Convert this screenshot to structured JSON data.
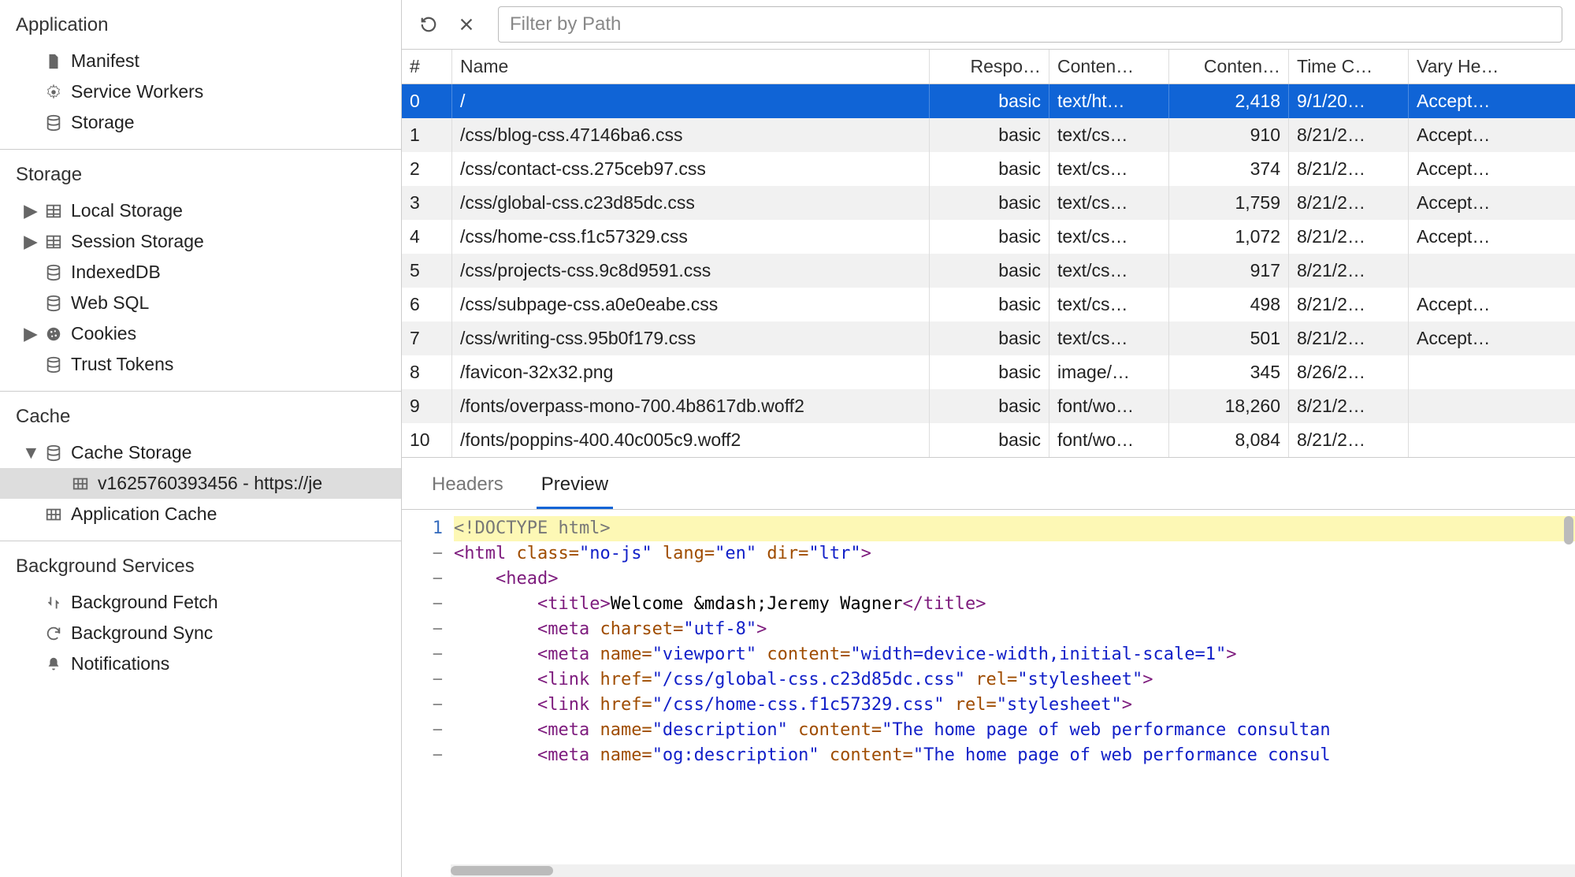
{
  "sidebar": {
    "groups": [
      {
        "title": "Application",
        "items": [
          {
            "icon": "file-icon",
            "label": "Manifest",
            "expandable": false
          },
          {
            "icon": "gear-icon",
            "label": "Service Workers",
            "expandable": false
          },
          {
            "icon": "storage-icon",
            "label": "Storage",
            "expandable": false
          }
        ]
      },
      {
        "title": "Storage",
        "items": [
          {
            "icon": "table-icon",
            "label": "Local Storage",
            "expandable": true
          },
          {
            "icon": "table-icon",
            "label": "Session Storage",
            "expandable": true
          },
          {
            "icon": "storage-icon",
            "label": "IndexedDB",
            "expandable": false
          },
          {
            "icon": "storage-icon",
            "label": "Web SQL",
            "expandable": false
          },
          {
            "icon": "cookie-icon",
            "label": "Cookies",
            "expandable": true
          },
          {
            "icon": "storage-icon",
            "label": "Trust Tokens",
            "expandable": false
          }
        ]
      },
      {
        "title": "Cache",
        "items": [
          {
            "icon": "storage-icon",
            "label": "Cache Storage",
            "expandable": true,
            "expanded": true,
            "children": [
              {
                "icon": "cells-icon",
                "label": "v1625760393456 - https://je",
                "selected": true
              }
            ]
          },
          {
            "icon": "cells-icon",
            "label": "Application Cache",
            "expandable": false
          }
        ]
      },
      {
        "title": "Background Services",
        "items": [
          {
            "icon": "fetch-icon",
            "label": "Background Fetch",
            "expandable": false
          },
          {
            "icon": "sync-icon",
            "label": "Background Sync",
            "expandable": false
          },
          {
            "icon": "bell-icon",
            "label": "Notifications",
            "expandable": false
          }
        ]
      }
    ]
  },
  "toolbar": {
    "filter_placeholder": "Filter by Path"
  },
  "table": {
    "columns": [
      {
        "key": "index",
        "label": "#"
      },
      {
        "key": "name",
        "label": "Name"
      },
      {
        "key": "resp",
        "label": "Respo…"
      },
      {
        "key": "ctype",
        "label": "Conten…"
      },
      {
        "key": "clen",
        "label": "Conten…"
      },
      {
        "key": "time",
        "label": "Time C…"
      },
      {
        "key": "vary",
        "label": "Vary He…"
      }
    ],
    "rows": [
      {
        "index": "0",
        "name": "/",
        "resp": "basic",
        "ctype": "text/ht…",
        "clen": "2,418",
        "time": "9/1/20…",
        "vary": "Accept…",
        "selected": true
      },
      {
        "index": "1",
        "name": "/css/blog-css.47146ba6.css",
        "resp": "basic",
        "ctype": "text/cs…",
        "clen": "910",
        "time": "8/21/2…",
        "vary": "Accept…"
      },
      {
        "index": "2",
        "name": "/css/contact-css.275ceb97.css",
        "resp": "basic",
        "ctype": "text/cs…",
        "clen": "374",
        "time": "8/21/2…",
        "vary": "Accept…"
      },
      {
        "index": "3",
        "name": "/css/global-css.c23d85dc.css",
        "resp": "basic",
        "ctype": "text/cs…",
        "clen": "1,759",
        "time": "8/21/2…",
        "vary": "Accept…"
      },
      {
        "index": "4",
        "name": "/css/home-css.f1c57329.css",
        "resp": "basic",
        "ctype": "text/cs…",
        "clen": "1,072",
        "time": "8/21/2…",
        "vary": "Accept…"
      },
      {
        "index": "5",
        "name": "/css/projects-css.9c8d9591.css",
        "resp": "basic",
        "ctype": "text/cs…",
        "clen": "917",
        "time": "8/21/2…",
        "vary": ""
      },
      {
        "index": "6",
        "name": "/css/subpage-css.a0e0eabe.css",
        "resp": "basic",
        "ctype": "text/cs…",
        "clen": "498",
        "time": "8/21/2…",
        "vary": "Accept…"
      },
      {
        "index": "7",
        "name": "/css/writing-css.95b0f179.css",
        "resp": "basic",
        "ctype": "text/cs…",
        "clen": "501",
        "time": "8/21/2…",
        "vary": "Accept…"
      },
      {
        "index": "8",
        "name": "/favicon-32x32.png",
        "resp": "basic",
        "ctype": "image/…",
        "clen": "345",
        "time": "8/26/2…",
        "vary": ""
      },
      {
        "index": "9",
        "name": "/fonts/overpass-mono-700.4b8617db.woff2",
        "resp": "basic",
        "ctype": "font/wo…",
        "clen": "18,260",
        "time": "8/21/2…",
        "vary": ""
      },
      {
        "index": "10",
        "name": "/fonts/poppins-400.40c005c9.woff2",
        "resp": "basic",
        "ctype": "font/wo…",
        "clen": "8,084",
        "time": "8/21/2…",
        "vary": ""
      }
    ]
  },
  "subtabs": {
    "headers": "Headers",
    "preview": "Preview",
    "active": "preview"
  },
  "code": {
    "first_line_number": "1",
    "lines": [
      {
        "gutter": "1",
        "hl": true,
        "tokens": [
          {
            "c": "tok-doct",
            "t": "<!DOCTYPE html>"
          }
        ]
      },
      {
        "gutter": "−",
        "tokens": [
          {
            "c": "tok-tag",
            "t": "<html "
          },
          {
            "c": "tok-attr",
            "t": "class="
          },
          {
            "c": "tok-str",
            "t": "\"no-js\""
          },
          {
            "c": "tok-tag",
            "t": " "
          },
          {
            "c": "tok-attr",
            "t": "lang="
          },
          {
            "c": "tok-str",
            "t": "\"en\""
          },
          {
            "c": "tok-tag",
            "t": " "
          },
          {
            "c": "tok-attr",
            "t": "dir="
          },
          {
            "c": "tok-str",
            "t": "\"ltr\""
          },
          {
            "c": "tok-tag",
            "t": ">"
          }
        ]
      },
      {
        "gutter": "−",
        "indent": 1,
        "tokens": [
          {
            "c": "tok-tag",
            "t": "<head>"
          }
        ]
      },
      {
        "gutter": "−",
        "indent": 2,
        "tokens": [
          {
            "c": "tok-tag",
            "t": "<title>"
          },
          {
            "c": "tok-text",
            "t": "Welcome &mdash;Jeremy Wagner"
          },
          {
            "c": "tok-tag",
            "t": "</title>"
          }
        ]
      },
      {
        "gutter": "−",
        "indent": 2,
        "tokens": [
          {
            "c": "tok-tag",
            "t": "<meta "
          },
          {
            "c": "tok-attr",
            "t": "charset="
          },
          {
            "c": "tok-str",
            "t": "\"utf-8\""
          },
          {
            "c": "tok-tag",
            "t": ">"
          }
        ]
      },
      {
        "gutter": "−",
        "indent": 2,
        "tokens": [
          {
            "c": "tok-tag",
            "t": "<meta "
          },
          {
            "c": "tok-attr",
            "t": "name="
          },
          {
            "c": "tok-str",
            "t": "\"viewport\""
          },
          {
            "c": "tok-tag",
            "t": " "
          },
          {
            "c": "tok-attr",
            "t": "content="
          },
          {
            "c": "tok-str",
            "t": "\"width=device-width,initial-scale=1\""
          },
          {
            "c": "tok-tag",
            "t": ">"
          }
        ]
      },
      {
        "gutter": "−",
        "indent": 2,
        "tokens": [
          {
            "c": "tok-tag",
            "t": "<link "
          },
          {
            "c": "tok-attr",
            "t": "href="
          },
          {
            "c": "tok-str",
            "t": "\"/css/global-css.c23d85dc.css\""
          },
          {
            "c": "tok-tag",
            "t": " "
          },
          {
            "c": "tok-attr",
            "t": "rel="
          },
          {
            "c": "tok-str",
            "t": "\"stylesheet\""
          },
          {
            "c": "tok-tag",
            "t": ">"
          }
        ]
      },
      {
        "gutter": "−",
        "indent": 2,
        "tokens": [
          {
            "c": "tok-tag",
            "t": "<link "
          },
          {
            "c": "tok-attr",
            "t": "href="
          },
          {
            "c": "tok-str",
            "t": "\"/css/home-css.f1c57329.css\""
          },
          {
            "c": "tok-tag",
            "t": " "
          },
          {
            "c": "tok-attr",
            "t": "rel="
          },
          {
            "c": "tok-str",
            "t": "\"stylesheet\""
          },
          {
            "c": "tok-tag",
            "t": ">"
          }
        ]
      },
      {
        "gutter": "−",
        "indent": 2,
        "tokens": [
          {
            "c": "tok-tag",
            "t": "<meta "
          },
          {
            "c": "tok-attr",
            "t": "name="
          },
          {
            "c": "tok-str",
            "t": "\"description\""
          },
          {
            "c": "tok-tag",
            "t": " "
          },
          {
            "c": "tok-attr",
            "t": "content="
          },
          {
            "c": "tok-str",
            "t": "\"The home page of web performance consultan"
          }
        ]
      },
      {
        "gutter": "−",
        "indent": 2,
        "tokens": [
          {
            "c": "tok-tag",
            "t": "<meta "
          },
          {
            "c": "tok-attr",
            "t": "name="
          },
          {
            "c": "tok-str",
            "t": "\"og:description\""
          },
          {
            "c": "tok-tag",
            "t": " "
          },
          {
            "c": "tok-attr",
            "t": "content="
          },
          {
            "c": "tok-str",
            "t": "\"The home page of web performance consul"
          }
        ]
      }
    ]
  }
}
